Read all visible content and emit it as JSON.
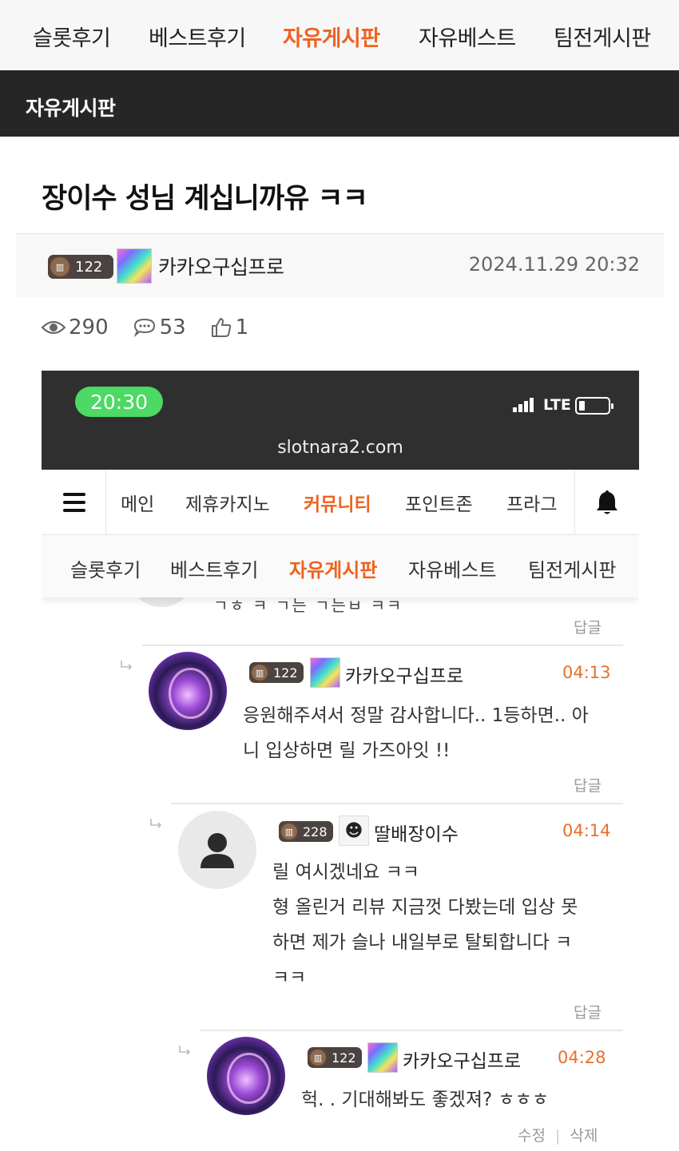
{
  "top_nav": {
    "tabs": [
      {
        "label": "슬롯후기",
        "active": false
      },
      {
        "label": "베스트후기",
        "active": false
      },
      {
        "label": "자유게시판",
        "active": true
      },
      {
        "label": "자유베스트",
        "active": false
      },
      {
        "label": "팀전게시판",
        "active": false
      }
    ]
  },
  "board": {
    "title": "자유게시판"
  },
  "post": {
    "title": "장이수 성님 계십니까유 ㅋㅋ",
    "author": {
      "level": "122",
      "name": "카카오구십프로"
    },
    "date": "2024.11.29 20:32",
    "stats": {
      "views": "290",
      "comments": "53",
      "likes": "1"
    }
  },
  "screenshot": {
    "phone": {
      "time": "20:30",
      "network": "LTE",
      "domain": "slotnara2.com"
    },
    "site_nav": {
      "items": [
        {
          "label": "메인",
          "active": false
        },
        {
          "label": "제휴카지노",
          "active": false
        },
        {
          "label": "커뮤니티",
          "active": true
        },
        {
          "label": "포인트존",
          "active": false
        },
        {
          "label": "프라그",
          "active": false
        }
      ]
    },
    "sub_nav": {
      "items": [
        {
          "label": "슬롯후기",
          "active": false
        },
        {
          "label": "베스트후기",
          "active": false
        },
        {
          "label": "자유게시판",
          "active": true
        },
        {
          "label": "자유베스트",
          "active": false
        },
        {
          "label": "팀전게시판",
          "active": false
        }
      ]
    },
    "cutoff_text": "ㄱㅎ ㅋ ㄱ는 ㄱ는ㅂ ㅋㅋ",
    "reply_label": "답글",
    "comments": [
      {
        "level": "122",
        "name": "카카오구십프로",
        "time": "04:13",
        "lines": [
          "응원해주셔서 정말 감사합니다.. 1등하면.. 아",
          "니 입상하면  릴 가즈아잇 !!"
        ]
      },
      {
        "level": "228",
        "name": "딸배장이수",
        "time": "04:14",
        "lines": [
          "릴 여시겠네요 ㅋㅋ",
          "형 올린거 리뷰 지금껏 다봤는데 입상 못",
          "하면 제가 슬나 내일부로 탈퇴합니다 ㅋ",
          "ㅋㅋ"
        ]
      },
      {
        "level": "122",
        "name": "카카오구십프로",
        "time": "04:28",
        "lines": [
          "헉. . 기대해봐도 좋겠져? ㅎㅎㅎ"
        ],
        "edit_label": "수정",
        "delete_label": "삭제"
      }
    ]
  }
}
